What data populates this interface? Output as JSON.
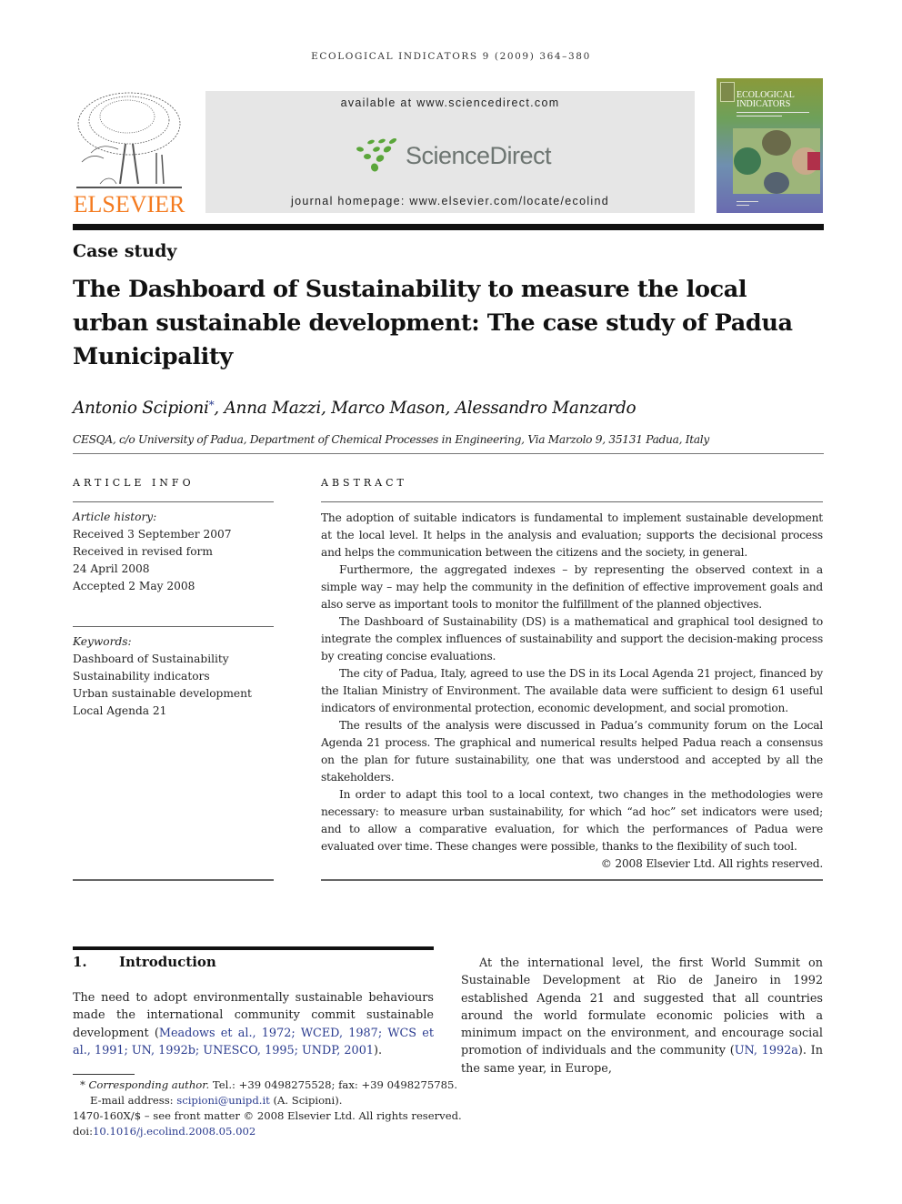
{
  "running_head": "ECOLOGICAL INDICATORS 9 (2009) 364–380",
  "publisher": {
    "logo_icon": "elsevier-tree-icon",
    "name": "ELSEVIER",
    "brand_color": "#f47b20"
  },
  "banner": {
    "available_at": "available at www.sciencedirect.com",
    "logo_icon": "sciencedirect-dots-icon",
    "logo_text": "ScienceDirect",
    "logo_dot_color": "#5aa63a",
    "journal_homepage": "journal homepage: www.elsevier.com/locate/ecolind"
  },
  "cover": {
    "title_line1": "ECOLOGICAL",
    "title_line2": "INDICATORS",
    "image_icon": "journal-cover-image"
  },
  "article": {
    "type": "Case study",
    "title": "The Dashboard of Sustainability to measure the local urban sustainable development: The case study of Padua Municipality",
    "authors": [
      {
        "name": "Antonio Scipioni",
        "corresponding": "*"
      },
      {
        "name": "Anna Mazzi"
      },
      {
        "name": "Marco Mason"
      },
      {
        "name": "Alessandro Manzardo"
      }
    ],
    "affiliation": "CESQA, c/o University of Padua, Department of Chemical Processes in Engineering, Via Marzolo 9, 35131 Padua, Italy"
  },
  "article_info": {
    "heading": "ARTICLE INFO",
    "history_label": "Article history:",
    "history": [
      "Received 3 September 2007",
      "Received in revised form",
      "24 April 2008",
      "Accepted 2 May 2008"
    ],
    "keywords_label": "Keywords:",
    "keywords": [
      "Dashboard of Sustainability",
      "Sustainability indicators",
      "Urban sustainable development",
      "Local Agenda 21"
    ]
  },
  "abstract": {
    "heading": "ABSTRACT",
    "paragraphs": [
      "The adoption of suitable indicators is fundamental to implement sustainable development at the local level. It helps in the analysis and evaluation; supports the decisional process and helps the communication between the citizens and the society, in general.",
      "Furthermore, the aggregated indexes – by representing the observed context in a simple way – may help the community in the definition of effective improvement goals and also serve as important tools to monitor the fulfillment of the planned objectives.",
      "The Dashboard of Sustainability (DS) is a mathematical and graphical tool designed to integrate the complex influences of sustainability and support the decision-making process by creating concise evaluations.",
      "The city of Padua, Italy, agreed to use the DS in its Local Agenda 21 project, financed by the Italian Ministry of Environment. The available data were sufficient to design 61 useful indicators of environmental protection, economic development, and social promotion.",
      "The results of the analysis were discussed in Padua’s community forum on the Local Agenda 21 process. The graphical and numerical results helped Padua reach a consensus on the plan for future sustainability, one that was understood and accepted by all the stakeholders.",
      "In order to adapt this tool to a local context, two changes in the methodologies were necessary: to measure urban sustainability, for which “ad hoc” set indicators were used; and to allow a comparative evaluation, for which the performances of Padua were evaluated over time. These changes were possible, thanks to the flexibility of such tool."
    ],
    "copyright": "© 2008 Elsevier Ltd. All rights reserved."
  },
  "introduction": {
    "number": "1.",
    "heading": "Introduction",
    "left_text": "The need to adopt environmentally sustainable behaviours made the international community commit sustainable development (",
    "left_citations": "Meadows et al., 1972; WCED, 1987; WCS et al., 1991; UN, 1992b; UNESCO, 1995; UNDP, 2001",
    "left_end": ").",
    "right_text": "At the international level, the first World Summit on Sustainable Development at Rio de Janeiro in 1992 established Agenda 21 and suggested that all countries around the world formulate economic policies with a minimum impact on the environment, and encourage social promotion of individuals and the community (",
    "right_citation": "UN, 1992a",
    "right_end": "). In the same year, in Europe,"
  },
  "footnotes": {
    "star": "*",
    "corresponding_label": "Corresponding author.",
    "contact": " Tel.: +39 0498275528; fax: +39 0498275785.",
    "email_label": "E-mail address: ",
    "email": "scipioni@unipd.it",
    "email_owner": " (A. Scipioni).",
    "issn_line": "1470-160X/$ – see front matter © 2008 Elsevier Ltd. All rights reserved.",
    "doi_label": "doi:",
    "doi": "10.1016/j.ecolind.2008.05.002"
  }
}
